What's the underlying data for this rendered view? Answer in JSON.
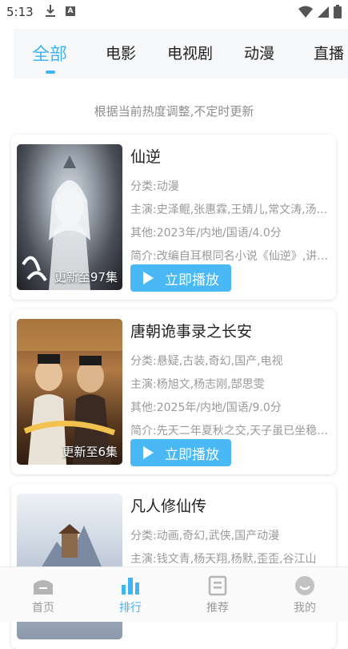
{
  "status_bar": {
    "time": "5:13"
  },
  "tabs": [
    {
      "label": "全部",
      "active": true
    },
    {
      "label": "电影"
    },
    {
      "label": "电视剧"
    },
    {
      "label": "动漫"
    },
    {
      "label": "直播"
    }
  ],
  "hint": "根据当前热度调整,不定时更新",
  "cards": [
    {
      "title": "仙逆",
      "category": "分类:动漫",
      "cast": "主演:史泽鲲,张惠霖,王婧儿,常文涛,汤水雨",
      "other": "其他:2023年/内地/国语/4.0分",
      "summary": "简介:改编自耳根同名小说《仙逆》,讲述了乡村平凡少年王林",
      "badge": "更新至97集",
      "play_label": "立即播放"
    },
    {
      "title": "唐朝诡事录之长安",
      "category": "分类:悬疑,古装,奇幻,国产,电视",
      "cast": "主演:杨旭文,杨志刚,郜思雯",
      "other": "其他:2025年/内地/国语/9.0分",
      "summary": "简介:先天二年夏秋之交,天子虽已坐稳皇位",
      "badge": "更新至6集",
      "play_label": "立即播放"
    },
    {
      "title": "凡人修仙传",
      "category": "分类:动画,奇幻,武侠,国产动漫",
      "cast": "主演:钱文青,杨天翔,杨默,歪歪,谷江山",
      "other": "",
      "summary": "",
      "badge": "",
      "play_label": ""
    }
  ],
  "bottom_nav": [
    {
      "label": "首页",
      "icon": "home-icon"
    },
    {
      "label": "排行",
      "icon": "ranking-icon",
      "active": true
    },
    {
      "label": "推荐",
      "icon": "recommend-icon"
    },
    {
      "label": "我的",
      "icon": "profile-icon"
    }
  ],
  "colors": {
    "accent": "#42b4f2",
    "play_button": "#4ab8f4"
  }
}
